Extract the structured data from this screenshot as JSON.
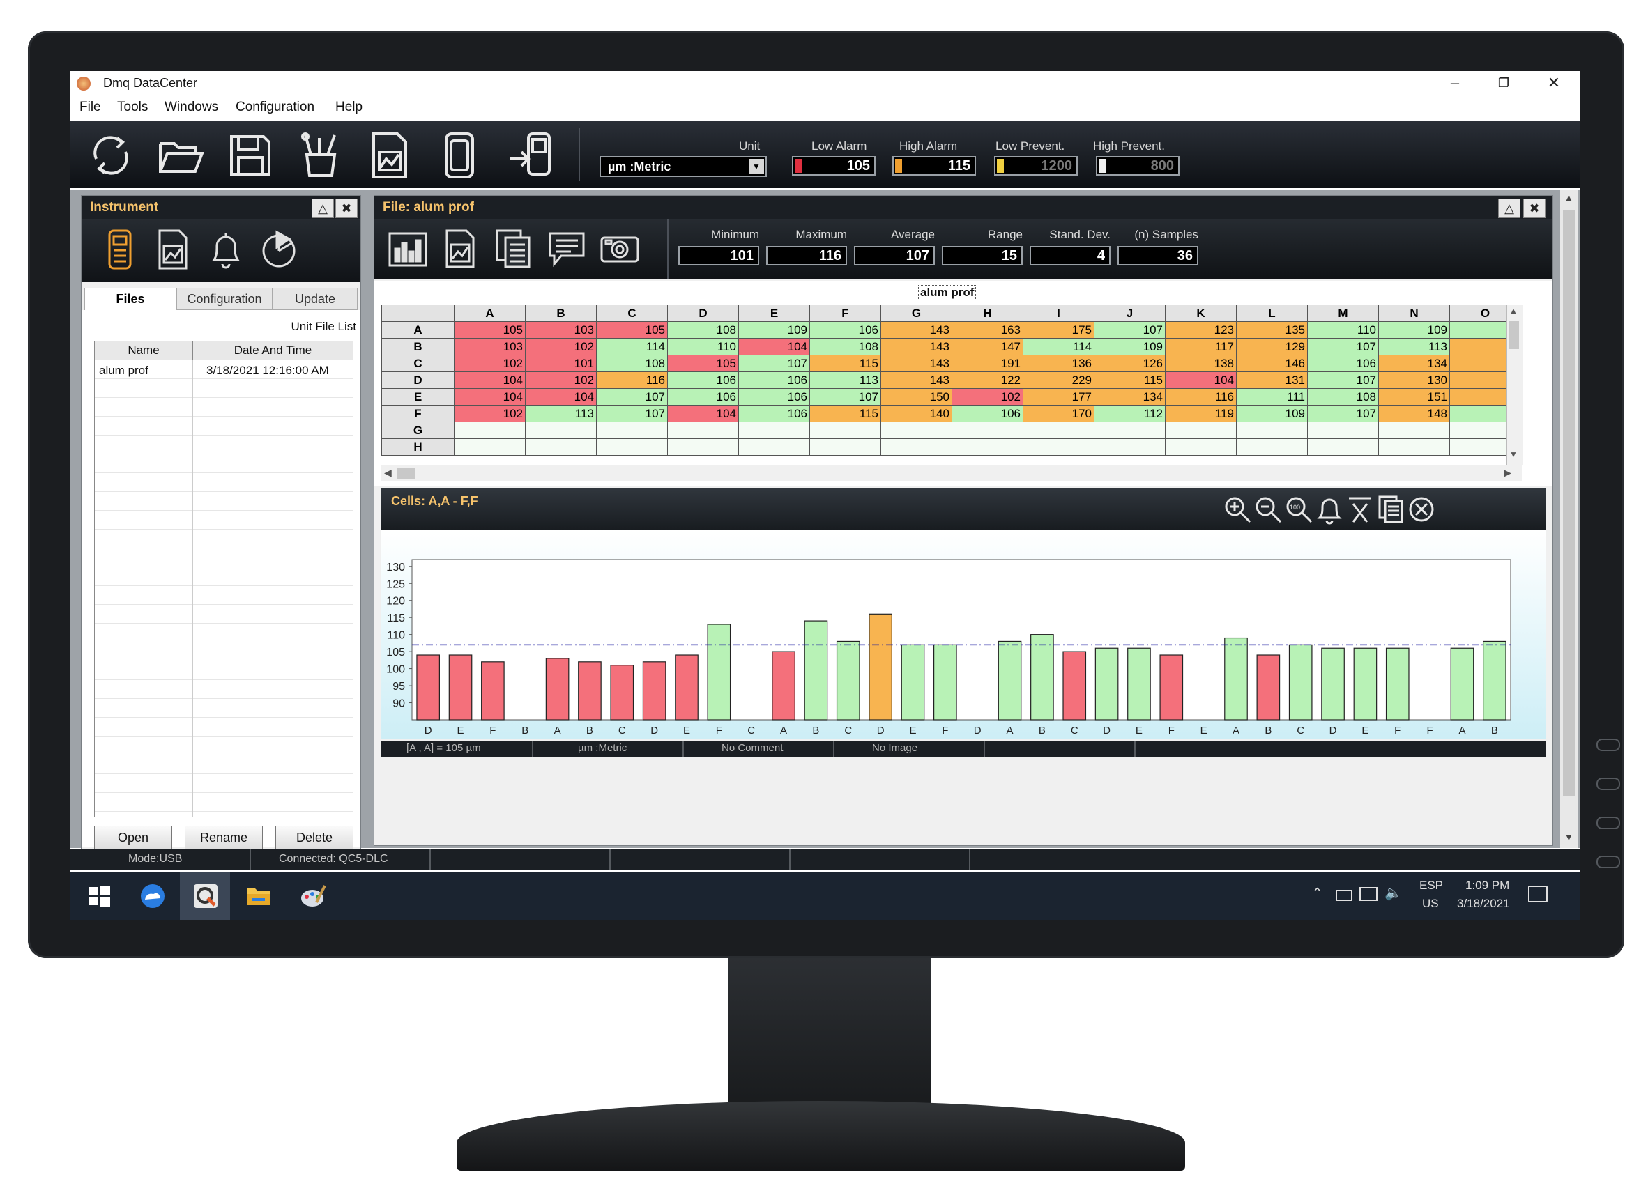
{
  "window": {
    "title": "Dmq DataCenter",
    "min_glyph": "–",
    "max_glyph": "❐",
    "close_glyph": "✕"
  },
  "menu": [
    "File",
    "Tools",
    "Windows",
    "Configuration",
    "Help"
  ],
  "toolbar": {
    "icons": [
      "sync-icon",
      "open-folder-icon",
      "save-icon",
      "tools-icon",
      "report-icon",
      "device-icon",
      "transfer-icon"
    ],
    "unit_label": "Unit",
    "unit_value": "µm :Metric",
    "fields": [
      {
        "label": "Low Alarm",
        "value": "105",
        "flag": "#e03040",
        "dim": false
      },
      {
        "label": "High Alarm",
        "value": "115",
        "flag": "#f0a030",
        "dim": false
      },
      {
        "label": "Low Prevent.",
        "value": "1200",
        "flag": "#f0d040",
        "dim": true
      },
      {
        "label": "High Prevent.",
        "value": "800",
        "flag": "#f0f0f0",
        "dim": true
      }
    ]
  },
  "instrument": {
    "title": "Instrument",
    "icons": [
      "gauge-device-icon",
      "chart-report-icon",
      "bell-icon",
      "pie-icon"
    ],
    "tabs": [
      "Files",
      "Configuration",
      "Update"
    ],
    "file_list_label": "Unit File List",
    "columns": [
      "Name",
      "Date And Time"
    ],
    "rows": [
      {
        "name": "alum prof",
        "date": "3/18/2021 12:16:00 AM"
      }
    ],
    "buttons": [
      "Open",
      "Rename",
      "Delete"
    ]
  },
  "file": {
    "title": "File: alum prof",
    "icons": [
      "bar-chart-icon",
      "image-report-icon",
      "document-list-icon",
      "comment-icon",
      "camera-icon"
    ],
    "stats": [
      {
        "label": "Minimum",
        "value": "101"
      },
      {
        "label": "Maximum",
        "value": "116"
      },
      {
        "label": "Average",
        "value": "107"
      },
      {
        "label": "Range",
        "value": "15"
      },
      {
        "label": "Stand. Dev.",
        "value": "4"
      },
      {
        "label": "(n) Samples",
        "value": "36"
      }
    ],
    "grid_title": "alum prof",
    "grid_columns": [
      "A",
      "B",
      "C",
      "D",
      "E",
      "F",
      "G",
      "H",
      "I",
      "J",
      "K",
      "L",
      "M",
      "N",
      "O"
    ],
    "grid_rows": [
      {
        "label": "A",
        "cells": [
          [
            "105",
            "r"
          ],
          [
            "103",
            "r"
          ],
          [
            "105",
            "r"
          ],
          [
            "108",
            "g"
          ],
          [
            "109",
            "g"
          ],
          [
            "106",
            "g"
          ],
          [
            "143",
            "o"
          ],
          [
            "163",
            "o"
          ],
          [
            "175",
            "o"
          ],
          [
            "107",
            "g"
          ],
          [
            "123",
            "o"
          ],
          [
            "135",
            "o"
          ],
          [
            "110",
            "g"
          ],
          [
            "109",
            "g"
          ],
          [
            "",
            "g"
          ]
        ]
      },
      {
        "label": "B",
        "cells": [
          [
            "103",
            "r"
          ],
          [
            "102",
            "r"
          ],
          [
            "114",
            "g"
          ],
          [
            "110",
            "g"
          ],
          [
            "104",
            "r"
          ],
          [
            "108",
            "g"
          ],
          [
            "143",
            "o"
          ],
          [
            "147",
            "o"
          ],
          [
            "114",
            "g"
          ],
          [
            "109",
            "g"
          ],
          [
            "117",
            "o"
          ],
          [
            "129",
            "o"
          ],
          [
            "107",
            "g"
          ],
          [
            "113",
            "g"
          ],
          [
            "",
            "o"
          ]
        ]
      },
      {
        "label": "C",
        "cells": [
          [
            "102",
            "r"
          ],
          [
            "101",
            "r"
          ],
          [
            "108",
            "g"
          ],
          [
            "105",
            "r"
          ],
          [
            "107",
            "g"
          ],
          [
            "115",
            "o"
          ],
          [
            "143",
            "o"
          ],
          [
            "191",
            "o"
          ],
          [
            "136",
            "o"
          ],
          [
            "126",
            "o"
          ],
          [
            "138",
            "o"
          ],
          [
            "146",
            "o"
          ],
          [
            "106",
            "g"
          ],
          [
            "134",
            "o"
          ],
          [
            "",
            "o"
          ]
        ]
      },
      {
        "label": "D",
        "cells": [
          [
            "104",
            "r"
          ],
          [
            "102",
            "r"
          ],
          [
            "116",
            "o"
          ],
          [
            "106",
            "g"
          ],
          [
            "106",
            "g"
          ],
          [
            "113",
            "g"
          ],
          [
            "143",
            "o"
          ],
          [
            "122",
            "o"
          ],
          [
            "229",
            "o"
          ],
          [
            "115",
            "o"
          ],
          [
            "104",
            "r"
          ],
          [
            "131",
            "o"
          ],
          [
            "107",
            "g"
          ],
          [
            "130",
            "o"
          ],
          [
            "",
            "o"
          ]
        ]
      },
      {
        "label": "E",
        "cells": [
          [
            "104",
            "r"
          ],
          [
            "104",
            "r"
          ],
          [
            "107",
            "g"
          ],
          [
            "106",
            "g"
          ],
          [
            "106",
            "g"
          ],
          [
            "107",
            "g"
          ],
          [
            "150",
            "o"
          ],
          [
            "102",
            "r"
          ],
          [
            "177",
            "o"
          ],
          [
            "134",
            "o"
          ],
          [
            "116",
            "o"
          ],
          [
            "111",
            "g"
          ],
          [
            "108",
            "g"
          ],
          [
            "151",
            "o"
          ],
          [
            "",
            "o"
          ]
        ]
      },
      {
        "label": "F",
        "cells": [
          [
            "102",
            "r"
          ],
          [
            "113",
            "g"
          ],
          [
            "107",
            "g"
          ],
          [
            "104",
            "r"
          ],
          [
            "106",
            "g"
          ],
          [
            "115",
            "o"
          ],
          [
            "140",
            "o"
          ],
          [
            "106",
            "g"
          ],
          [
            "170",
            "o"
          ],
          [
            "112",
            "g"
          ],
          [
            "119",
            "o"
          ],
          [
            "109",
            "g"
          ],
          [
            "107",
            "g"
          ],
          [
            "148",
            "o"
          ],
          [
            "",
            "g"
          ]
        ]
      },
      {
        "label": "G",
        "cells": [
          [
            "",
            "e"
          ],
          [
            "",
            "e"
          ],
          [
            "",
            "e"
          ],
          [
            "",
            "e"
          ],
          [
            "",
            "e"
          ],
          [
            "",
            "e"
          ],
          [
            "",
            "e"
          ],
          [
            "",
            "e"
          ],
          [
            "",
            "e"
          ],
          [
            "",
            "e"
          ],
          [
            "",
            "e"
          ],
          [
            "",
            "e"
          ],
          [
            "",
            "e"
          ],
          [
            "",
            "e"
          ],
          [
            "",
            "e"
          ]
        ]
      },
      {
        "label": "H",
        "cells": [
          [
            "",
            "e"
          ],
          [
            "",
            "e"
          ],
          [
            "",
            "e"
          ],
          [
            "",
            "e"
          ],
          [
            "",
            "e"
          ],
          [
            "",
            "e"
          ],
          [
            "",
            "e"
          ],
          [
            "",
            "e"
          ],
          [
            "",
            "e"
          ],
          [
            "",
            "e"
          ],
          [
            "",
            "e"
          ],
          [
            "",
            "e"
          ],
          [
            "",
            "e"
          ],
          [
            "",
            "e"
          ],
          [
            "",
            "e"
          ]
        ]
      }
    ],
    "chart_header": "Cells: A,A - F,F",
    "chart_tools": [
      "zoom-in-icon",
      "zoom-out-icon",
      "zoom-100-icon",
      "alarm-bell-icon",
      "x-bar-icon",
      "copy-icon",
      "close-chart-icon"
    ],
    "status": [
      "[A , A] = 105 µm",
      "µm :Metric",
      "No Comment",
      "No Image"
    ]
  },
  "chart_data": {
    "type": "bar",
    "title": "",
    "xlabel": "",
    "ylabel": "",
    "ylim": [
      85,
      132
    ],
    "yticks": [
      90,
      95,
      100,
      105,
      110,
      115,
      120,
      125,
      130
    ],
    "average_line": 107,
    "categories": [
      "D",
      "E",
      "F",
      "B",
      "A",
      "B",
      "C",
      "D",
      "E",
      "F",
      "C",
      "A",
      "B",
      "C",
      "D",
      "E",
      "F",
      "D",
      "A",
      "B",
      "C",
      "D",
      "E",
      "F",
      "E",
      "A",
      "B",
      "C",
      "D",
      "E",
      "F",
      "F",
      "A",
      "B"
    ],
    "values": [
      104,
      104,
      102,
      null,
      103,
      102,
      101,
      102,
      104,
      113,
      null,
      105,
      114,
      108,
      116,
      107,
      107,
      null,
      108,
      110,
      105,
      106,
      106,
      104,
      null,
      109,
      104,
      107,
      106,
      106,
      106,
      null,
      106,
      108
    ],
    "colors": [
      "r",
      "r",
      "r",
      null,
      "r",
      "r",
      "r",
      "r",
      "r",
      "g",
      null,
      "r",
      "g",
      "g",
      "o",
      "g",
      "g",
      null,
      "g",
      "g",
      "r",
      "g",
      "g",
      "r",
      null,
      "g",
      "r",
      "g",
      "g",
      "g",
      "g",
      null,
      "g",
      "g"
    ],
    "palette": {
      "r": "#f4707b",
      "g": "#b8f2b6",
      "o": "#f8b450"
    }
  },
  "status": {
    "mode": "Mode:USB",
    "connected": "Connected: QC5-DLC"
  },
  "taskbar": {
    "apps": [
      "windows-start-icon",
      "onedrive-icon",
      "datacenter-app-icon",
      "file-explorer-icon",
      "paint-icon"
    ],
    "lang": "ESP",
    "region": "US",
    "time": "1:09 PM",
    "date": "3/18/2021"
  }
}
